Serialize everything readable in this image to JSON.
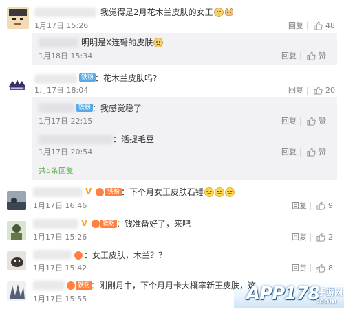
{
  "comments": [
    {
      "text": "我觉得是2月花木兰皮肤的女王",
      "time": "1月17日 15:26",
      "reply": "回复",
      "likes": "48"
    },
    {
      "text": "：花木兰皮肤吗?",
      "tag": "铁粉",
      "time": "1月17日 18:04",
      "reply": "回复",
      "likes": "20",
      "more_replies": "共5条回复"
    },
    {
      "text": "：下个月女王皮肤石锤",
      "tag": "铁粉",
      "time": "1月17日 16:46",
      "reply": "回复",
      "likes": "9"
    },
    {
      "text": "：钱准备好了，来吧",
      "tag": "铁粉",
      "time": "1月17日 15:26",
      "reply": "回复",
      "likes": "2"
    },
    {
      "text": "：女王皮肤，木兰？？",
      "time": "1月17日 15:42",
      "reply": "回复",
      "likes": "8"
    },
    {
      "text": "：刚刚月中，下个月月卡大概率新王皮肤，这",
      "tag": "铁粉",
      "time": "1月17日 15:55",
      "reply": "回复",
      "likes": ""
    }
  ],
  "sub_replies": [
    {
      "text": "明明是X连弩的皮肤",
      "time": "1月18日 15:34",
      "reply": "回复",
      "likes": "赞"
    },
    {
      "text": "：我感觉稳了",
      "tag": "铁粉",
      "time": "1月17日 22:15",
      "reply": "回复",
      "likes": "赞"
    },
    {
      "text": "：活捉毛豆",
      "time": "1月17日 20:54",
      "reply": "回复",
      "likes": "赞"
    }
  ],
  "watermark": {
    "brand": "APP178",
    "suffix": ".com",
    "cn": "手游网"
  },
  "colors": {
    "accent_green": "#5fb14f",
    "tag_blue": "#5aa9e6",
    "tag_orange": "#ff8140",
    "subbox_bg": "#f2f2f5"
  }
}
